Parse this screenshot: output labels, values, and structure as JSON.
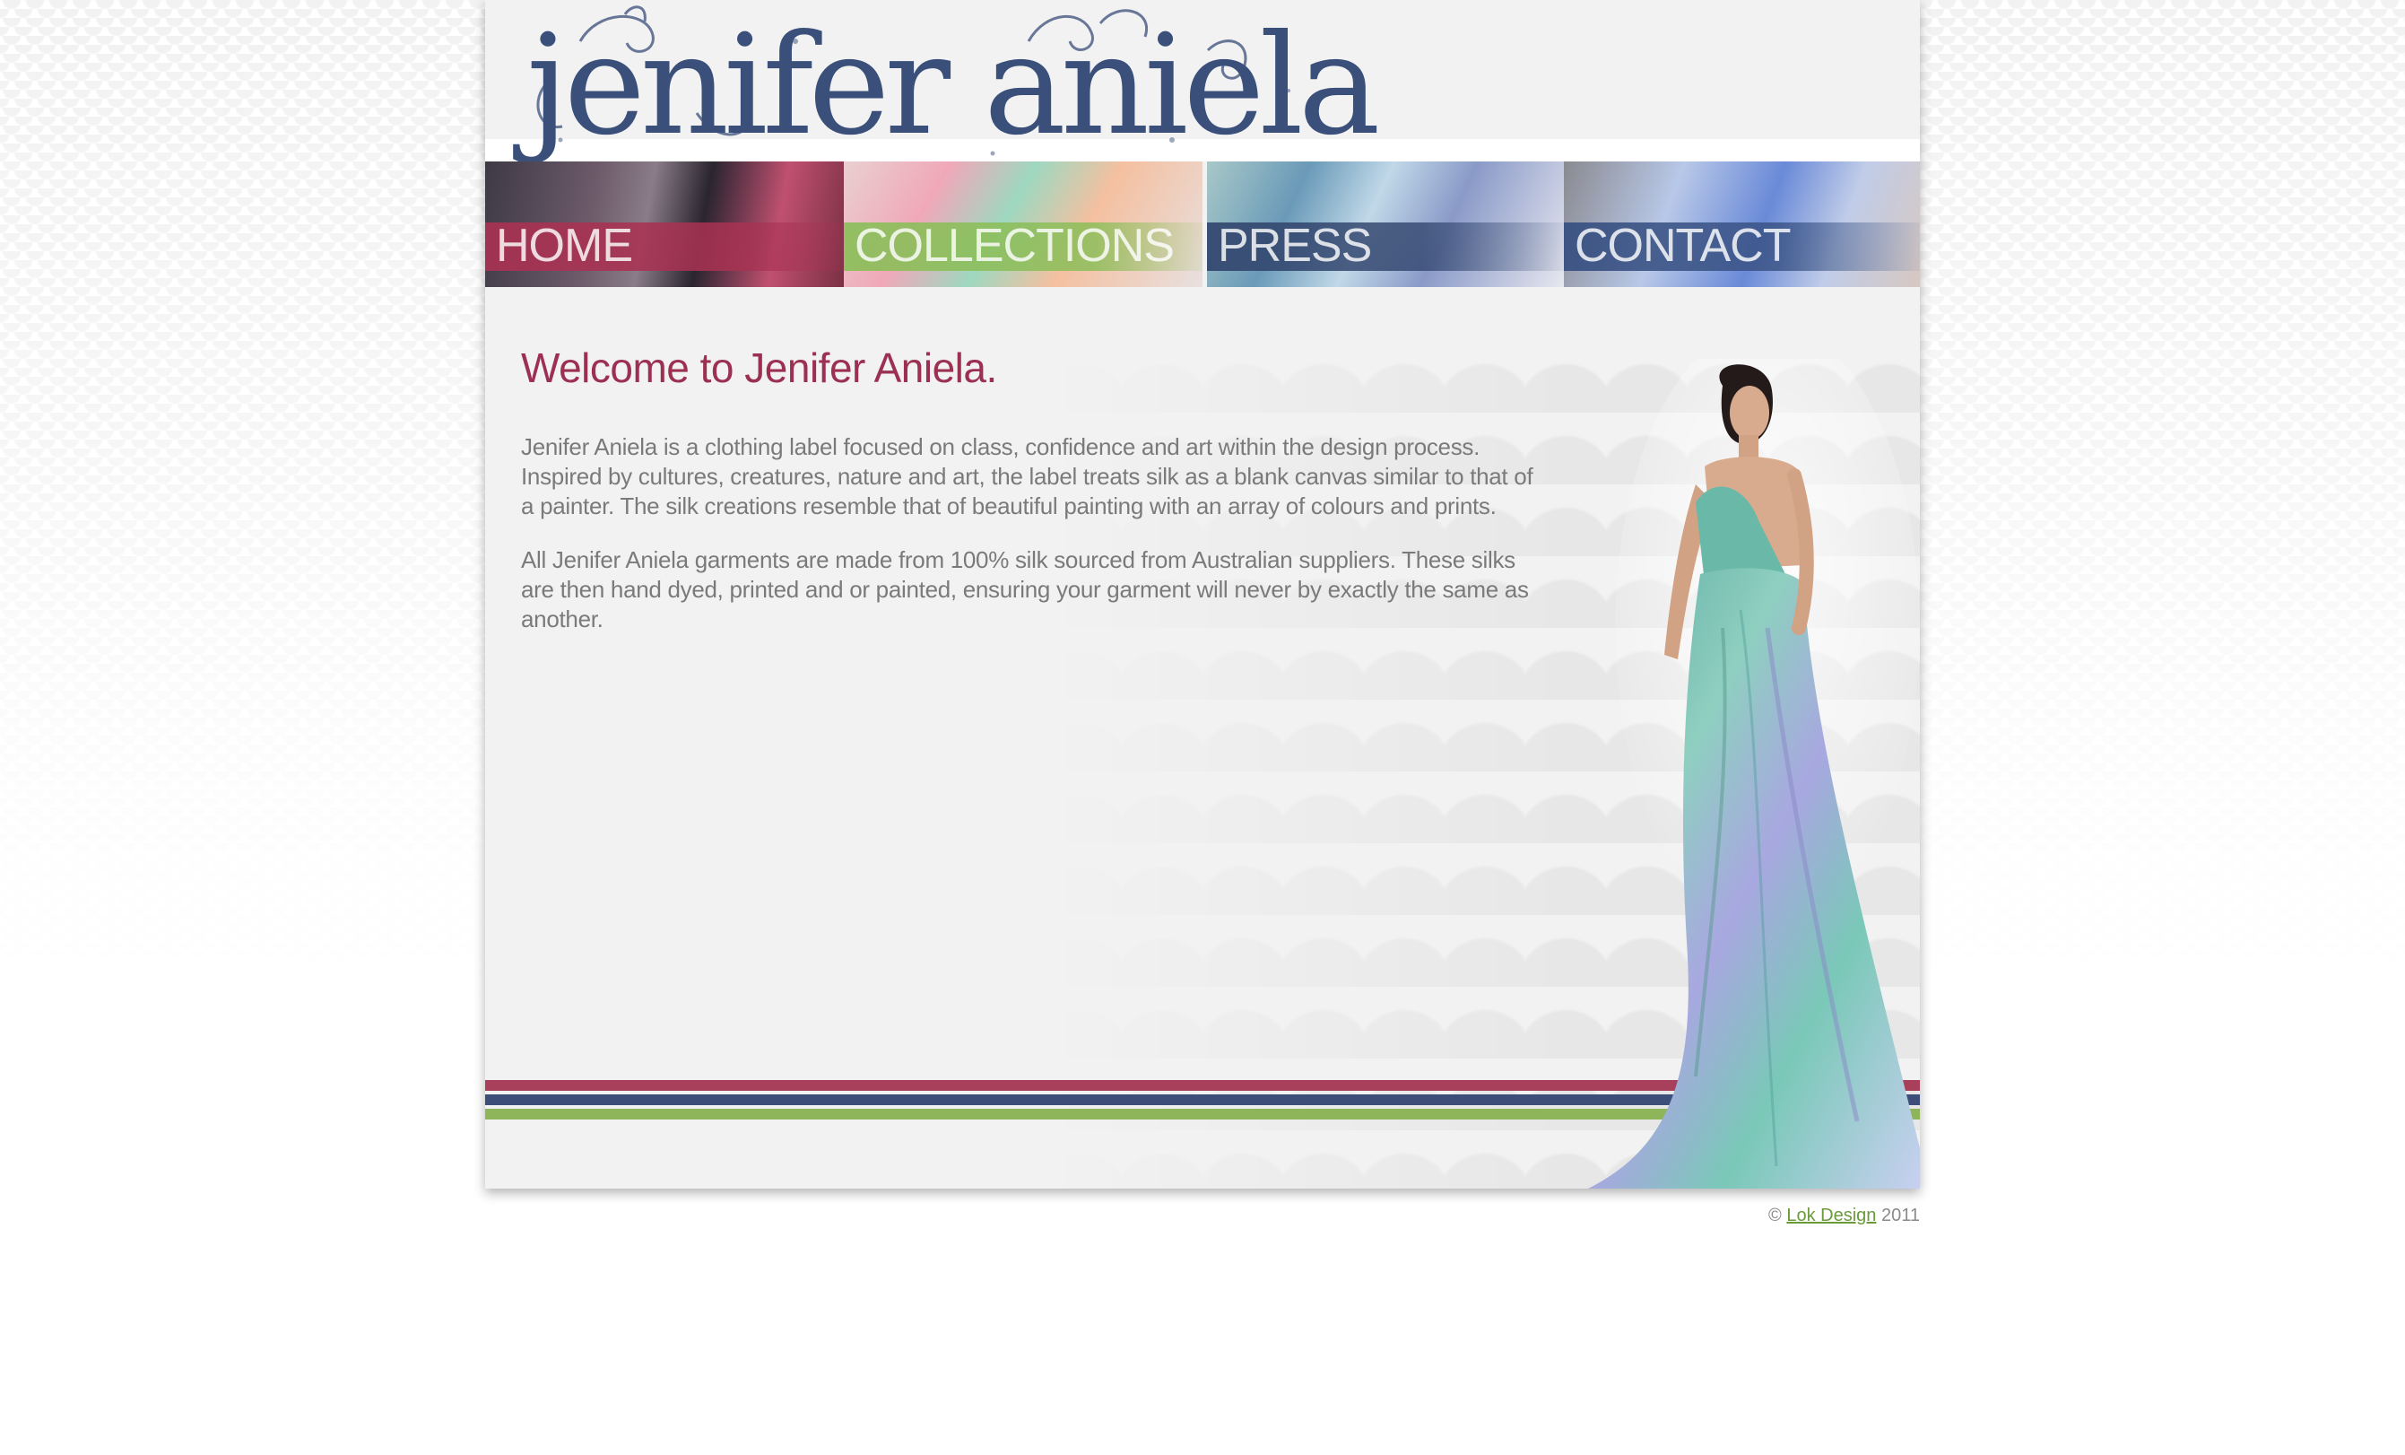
{
  "brand": {
    "logo_text": "jenifer aniela"
  },
  "nav": [
    {
      "label": "HOME"
    },
    {
      "label": "COLLECTIONS"
    },
    {
      "label": "PRESS"
    },
    {
      "label": "CONTACT"
    }
  ],
  "main": {
    "heading": "Welcome to Jenifer Aniela.",
    "paragraphs": [
      "Jenifer Aniela is a clothing label focused on class, confidence and art within the design process. Inspired by cultures, creatures, nature and art, the label treats silk as a blank canvas similar to that of a painter. The silk creations resemble that of beautiful painting with an array of colours and prints.",
      "All Jenifer Aniela garments are made from 100% silk sourced from Australian suppliers. These silks are then hand dyed, printed and or painted, ensuring your garment will never by exactly the same as another."
    ]
  },
  "footer": {
    "copyright_symbol": "©",
    "link_text": "Lok Design",
    "year": "2011"
  },
  "colors": {
    "logo_blue": "#3a4f7a",
    "heading_magenta": "#9c3053",
    "stripe_red": "#a8405c",
    "stripe_blue": "#3d4f78",
    "stripe_green": "#8fb55a",
    "footer_link_green": "#6a9a3a"
  }
}
